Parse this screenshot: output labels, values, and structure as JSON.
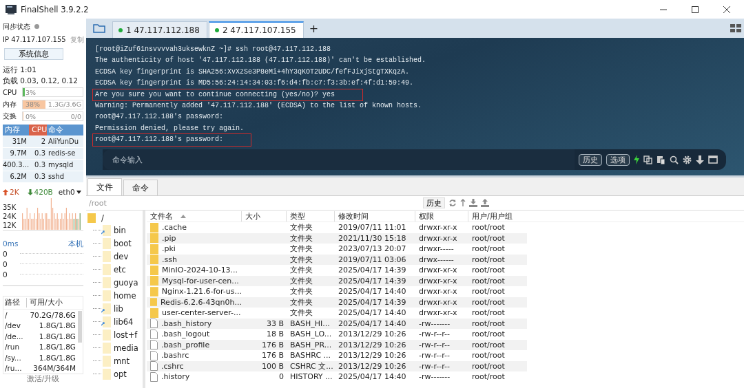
{
  "window": {
    "title": "FinalShell 3.9.2.2"
  },
  "sidebar": {
    "sync_label": "同步状态",
    "ip": "IP 47.117.107.155",
    "copy": "复制",
    "sysinfo_button": "系统信息",
    "uptime": "运行 1:01",
    "load": "负载 0.03, 0.12, 0.12",
    "meters": [
      {
        "label": "CPU",
        "level": 0.03,
        "reading": "3%"
      },
      {
        "label": "内存",
        "level": 0.38,
        "reading": "38%",
        "detail": "1.3G/3.6G"
      },
      {
        "label": "交换",
        "level": 0,
        "reading": "0%",
        "detail": "0/0"
      }
    ],
    "processes": {
      "columns": [
        "内存",
        "CPU",
        "命令"
      ],
      "rows": [
        {
          "mem": "31M",
          "cpu": "2",
          "command": "AliYunDu"
        },
        {
          "mem": "9.7M",
          "cpu": "0.3",
          "command": "redis-se"
        },
        {
          "mem": "400.3...",
          "cpu": "0.3",
          "command": "mysqld"
        },
        {
          "mem": "6.2M",
          "cpu": "0.3",
          "command": "sshd"
        }
      ]
    },
    "network": {
      "up": "2K",
      "down": "420B",
      "interface": "eth0",
      "yticks": [
        "35K",
        "24K",
        "12K"
      ]
    },
    "ping": {
      "latency": "0ms",
      "host": "本机",
      "values": [
        "0",
        "0",
        "0"
      ]
    },
    "disks": {
      "columns": [
        "路径",
        "可用/大小"
      ],
      "rows": [
        {
          "path": "/",
          "size": "70.2G/78.6G"
        },
        {
          "path": "/dev",
          "size": "1.8G/1.8G"
        },
        {
          "path": "/de...",
          "size": "1.8G/1.8G"
        },
        {
          "path": "/run",
          "size": "1.8G/1.8G"
        },
        {
          "path": "/sy...",
          "size": "1.8G/1.8G"
        },
        {
          "path": "/ru...",
          "size": "364M/364M"
        }
      ]
    },
    "footer": "激活/升级"
  },
  "tabs": [
    {
      "label": "1 47.117.112.188",
      "selected": false
    },
    {
      "label": "2 47.117.107.155",
      "selected": true
    }
  ],
  "add_tab": "+",
  "terminal": {
    "lines": [
      {
        "text": "[root@iZuf61nsvvvvah3uksewknZ ~]# ssh root@47.117.112.188",
        "highlight": false
      },
      {
        "text": "The authenticity of host '47.117.112.188 (47.117.112.188)' can't be established.",
        "highlight": false
      },
      {
        "text": "ECDSA key fingerprint is SHA256:XvXzSe3P8eMi+4hY3qKOT2UDC/fefFJixjStgTXKqzA.",
        "highlight": false
      },
      {
        "text": "ECDSA key fingerprint is MD5:56:24:14:34:03:f6:d4:fb:c7:f3:3b:ef:4f:d1:59:49.",
        "highlight": false
      },
      {
        "text": "Are you sure you want to continue connecting (yes/no)? yes",
        "highlight": true
      },
      {
        "text": "Warning: Permanently added '47.117.112.188' (ECDSA) to the list of known hosts.",
        "highlight": false
      },
      {
        "text": "root@47.117.112.188's password:",
        "highlight": false
      },
      {
        "text": "Permission denied, please try again.",
        "highlight": false
      },
      {
        "text": "root@47.117.112.188's password:",
        "highlight": true
      }
    ],
    "command_placeholder": "命令输入",
    "buttons": [
      "历史",
      "选项"
    ]
  },
  "bottom_tabs": [
    {
      "label": "文件",
      "selected": true
    },
    {
      "label": "命令",
      "selected": false
    }
  ],
  "path": "/root",
  "history_button": "历史",
  "tree": {
    "label": "/",
    "children": [
      {
        "label": "bin",
        "link": true
      },
      {
        "label": "boot",
        "link": false
      },
      {
        "label": "dev",
        "link": false
      },
      {
        "label": "etc",
        "link": false
      },
      {
        "label": "guoya",
        "link": false
      },
      {
        "label": "home",
        "link": false
      },
      {
        "label": "lib",
        "link": true
      },
      {
        "label": "lib64",
        "link": true
      },
      {
        "label": "lost+f",
        "link": false
      },
      {
        "label": "media",
        "link": false
      },
      {
        "label": "mnt",
        "link": false
      },
      {
        "label": "opt",
        "link": false
      }
    ]
  },
  "files": {
    "columns": [
      "文件名",
      "大小",
      "类型",
      "修改时间",
      "权限",
      "用户/用户组"
    ],
    "rows": [
      {
        "kind": "folder",
        "name": ".cache",
        "size": "",
        "type": "文件夹",
        "modified": "2019/07/11 11:01",
        "perms": "drwxr-xr-x",
        "owner": "root/root"
      },
      {
        "kind": "folder",
        "name": ".pip",
        "type": "文件夹",
        "modified": "2021/11/30 15:18",
        "perms": "drwxr-xr-x",
        "owner": "root/root"
      },
      {
        "kind": "folder",
        "name": ".pki",
        "type": "文件夹",
        "modified": "2023/07/13 20:07",
        "perms": "drwxr-----",
        "owner": "root/root"
      },
      {
        "kind": "folder",
        "name": ".ssh",
        "type": "文件夹",
        "modified": "2019/07/11 03:06",
        "perms": "drwx------",
        "owner": "root/root"
      },
      {
        "kind": "folder",
        "name": "MinIO-2024-10-13...",
        "type": "文件夹",
        "modified": "2025/04/17 14:39",
        "perms": "drwxr-xr-x",
        "owner": "root/root"
      },
      {
        "kind": "folder",
        "name": "Mysql-for-user-cen...",
        "type": "文件夹",
        "modified": "2025/04/17 14:39",
        "perms": "drwxr-xr-x",
        "owner": "root/root"
      },
      {
        "kind": "folder",
        "name": "Nginx-1.21.6-for-us...",
        "type": "文件夹",
        "modified": "2025/04/17 14:40",
        "perms": "drwxr-xr-x",
        "owner": "root/root"
      },
      {
        "kind": "folder",
        "name": "Redis-6.2.6-43qn0h...",
        "type": "文件夹",
        "modified": "2025/04/17 14:39",
        "perms": "drwxr-xr-x",
        "owner": "root/root"
      },
      {
        "kind": "folder",
        "name": "user-center-server-...",
        "type": "文件夹",
        "modified": "2025/04/17 14:40",
        "perms": "drwxr-xr-x",
        "owner": "root/root"
      },
      {
        "kind": "file",
        "name": ".bash_history",
        "size": "33 B",
        "type": "BASH_HI...",
        "modified": "2025/04/17 14:40",
        "perms": "-rw-------",
        "owner": "root/root"
      },
      {
        "kind": "file",
        "name": ".bash_logout",
        "size": "18 B",
        "type": "BASH_LO...",
        "modified": "2013/12/29 10:26",
        "perms": "-rw-r--r--",
        "owner": "root/root"
      },
      {
        "kind": "file",
        "name": ".bash_profile",
        "size": "176 B",
        "type": "BASH_PR...",
        "modified": "2013/12/29 10:26",
        "perms": "-rw-r--r--",
        "owner": "root/root"
      },
      {
        "kind": "file",
        "name": ".bashrc",
        "size": "176 B",
        "type": "BASHRC ...",
        "modified": "2013/12/29 10:26",
        "perms": "-rw-r--r--",
        "owner": "root/root"
      },
      {
        "kind": "file",
        "name": ".cshrc",
        "size": "100 B",
        "type": "CSHRC 文...",
        "modified": "2013/12/29 10:26",
        "perms": "-rw-r--r--",
        "owner": "root/root"
      },
      {
        "kind": "file",
        "name": ".history",
        "size": "0",
        "type": "HISTORY ...",
        "modified": "2025/04/17 14:40",
        "perms": "-rw-------",
        "owner": "root/root"
      }
    ]
  }
}
